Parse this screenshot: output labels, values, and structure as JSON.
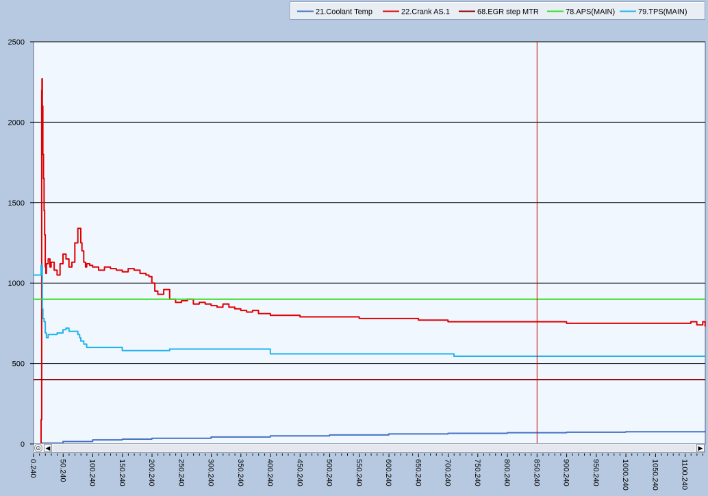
{
  "chart_data": {
    "type": "line",
    "title": "",
    "xlabel": "",
    "ylabel": "",
    "ylim": [
      0,
      2500
    ],
    "xlim": [
      0.24,
      1134.24
    ],
    "y_ticks": [
      "0",
      "500",
      "1000",
      "1500",
      "2000",
      "2500"
    ],
    "x_ticks": [
      "0.240",
      "50.240",
      "100.240",
      "150.240",
      "200.240",
      "250.240",
      "300.240",
      "350.240",
      "400.240",
      "450.240",
      "500.240",
      "550.240",
      "600.240",
      "650.240",
      "700.240",
      "750.240",
      "800.240",
      "850.240",
      "900.240",
      "950.240",
      "1000.240",
      "1050.240",
      "1100.240"
    ],
    "grid": "horizontal",
    "legend_position": "top-right",
    "cursor_x": 850.24,
    "series": [
      {
        "name": "21.Coolant Temp",
        "color": "#4472c4",
        "x": [
          13,
          50,
          100,
          150,
          200,
          300,
          400,
          500,
          600,
          700,
          800,
          900,
          1000,
          1134
        ],
        "y": [
          5,
          15,
          25,
          30,
          35,
          43,
          50,
          56,
          62,
          66,
          70,
          73,
          76,
          82
        ]
      },
      {
        "name": "22.Crank AS.1",
        "color": "#e00000",
        "x": [
          12,
          13,
          14,
          14.5,
          15,
          16,
          17,
          18,
          19,
          20,
          21,
          22,
          25,
          28,
          30,
          35,
          40,
          45,
          50,
          55,
          60,
          65,
          70,
          75,
          80,
          82,
          85,
          88,
          90,
          95,
          100,
          110,
          120,
          130,
          140,
          150,
          160,
          170,
          180,
          190,
          195,
          200,
          205,
          210,
          220,
          230,
          240,
          250,
          260,
          270,
          280,
          290,
          300,
          310,
          320,
          330,
          340,
          350,
          360,
          370,
          380,
          400,
          450,
          500,
          550,
          600,
          650,
          700,
          750,
          800,
          850,
          900,
          950,
          1000,
          1050,
          1100,
          1110,
          1120,
          1130,
          1134
        ],
        "y": [
          0,
          150,
          2200,
          2270,
          2100,
          1800,
          1650,
          1450,
          1300,
          1100,
          1060,
          1120,
          1150,
          1100,
          1130,
          1080,
          1050,
          1120,
          1180,
          1150,
          1100,
          1130,
          1250,
          1340,
          1250,
          1200,
          1130,
          1100,
          1120,
          1110,
          1100,
          1080,
          1100,
          1090,
          1080,
          1070,
          1090,
          1080,
          1060,
          1050,
          1040,
          1000,
          950,
          930,
          960,
          900,
          880,
          890,
          900,
          870,
          880,
          870,
          860,
          850,
          870,
          850,
          840,
          830,
          820,
          830,
          810,
          800,
          790,
          790,
          780,
          780,
          770,
          760,
          760,
          760,
          760,
          750,
          750,
          750,
          750,
          750,
          760,
          740,
          760,
          730
        ]
      },
      {
        "name": "68.EGR step MTR",
        "color": "#8b0000",
        "x": [
          0.24,
          1134.24
        ],
        "y": [
          400,
          400
        ]
      },
      {
        "name": "78.APS(MAIN)",
        "color": "#32e01e",
        "x": [
          0.24,
          1134.24
        ],
        "y": [
          900,
          900
        ]
      },
      {
        "name": "79.TPS(MAIN)",
        "color": "#1fb4ec",
        "x": [
          0.24,
          12,
          13,
          15,
          16,
          18,
          20,
          22,
          25,
          30,
          40,
          50,
          55,
          60,
          70,
          75,
          78,
          80,
          85,
          90,
          100,
          150,
          200,
          230,
          400,
          700,
          710,
          1134
        ],
        "y": [
          1050,
          1050,
          1110,
          840,
          780,
          760,
          690,
          660,
          680,
          680,
          690,
          710,
          720,
          700,
          700,
          680,
          660,
          640,
          620,
          600,
          600,
          580,
          580,
          590,
          560,
          560,
          545,
          545
        ]
      }
    ]
  }
}
